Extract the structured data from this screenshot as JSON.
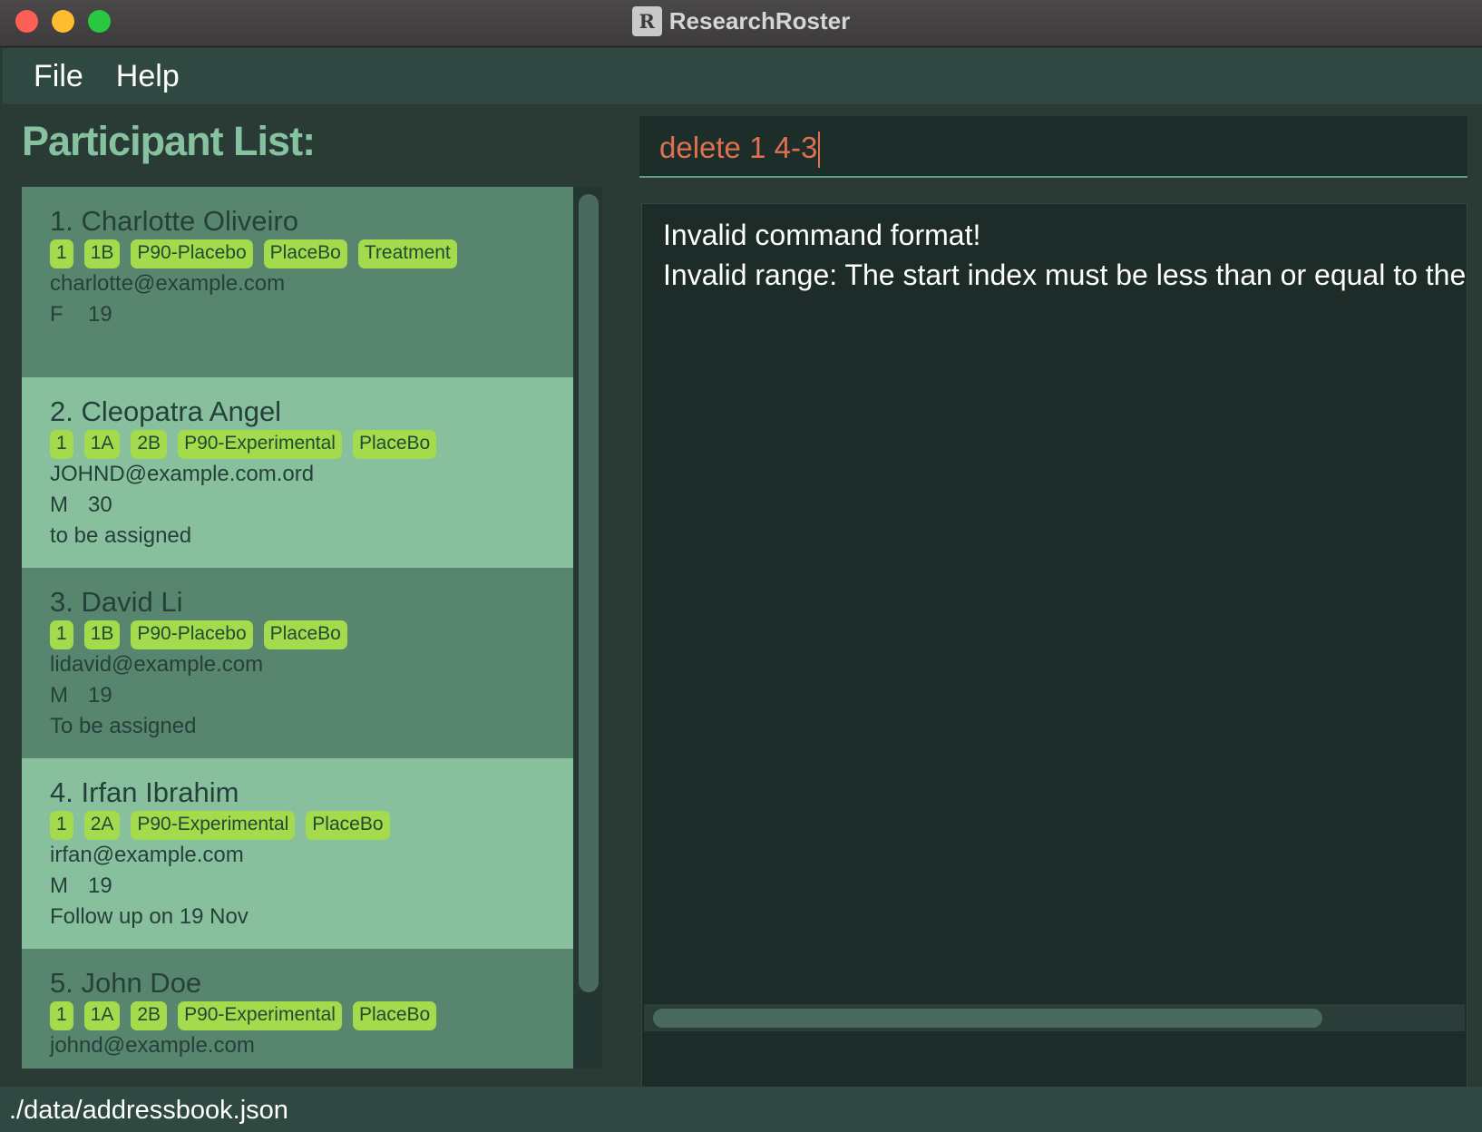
{
  "window": {
    "title": "ResearchRoster",
    "logo_text": "R"
  },
  "menu": {
    "file_label": "File",
    "help_label": "Help"
  },
  "participant_list": {
    "title": "Participant List:",
    "participants": [
      {
        "name": "1. Charlotte Oliveiro",
        "tags": [
          "1",
          "1B",
          "P90-Placebo",
          "PlaceBo",
          "Treatment"
        ],
        "email": "charlotte@example.com",
        "gender": "F",
        "age": "19",
        "note": ""
      },
      {
        "name": "2. Cleopatra Angel",
        "tags": [
          "1",
          "1A",
          "2B",
          "P90-Experimental",
          "PlaceBo"
        ],
        "email": "JOHND@example.com.ord",
        "gender": "M",
        "age": "30",
        "note": "to be assigned"
      },
      {
        "name": "3. David Li",
        "tags": [
          "1",
          "1B",
          "P90-Placebo",
          "PlaceBo"
        ],
        "email": "lidavid@example.com",
        "gender": "M",
        "age": "19",
        "note": "To be assigned"
      },
      {
        "name": "4. Irfan Ibrahim",
        "tags": [
          "1",
          "2A",
          "P90-Experimental",
          "PlaceBo"
        ],
        "email": "irfan@example.com",
        "gender": "M",
        "age": "19",
        "note": "Follow up on 19 Nov"
      },
      {
        "name": "5. John Doe",
        "tags": [
          "1",
          "1A",
          "2B",
          "P90-Experimental",
          "PlaceBo"
        ],
        "email": "johnd@example.com",
        "gender": "",
        "age": "",
        "note": ""
      }
    ]
  },
  "command": {
    "value": "delete 1 4-3"
  },
  "result": {
    "line1": "Invalid command format!",
    "line2": "Invalid range: The start index must be less than or equal to the"
  },
  "status": {
    "file_path": "./data/addressbook.json"
  },
  "colors": {
    "tag_bg": "#a4db4d",
    "card_dark": "#58856e",
    "card_light": "#88c09e",
    "command_text": "#e07050",
    "title_green": "#86c29f"
  }
}
